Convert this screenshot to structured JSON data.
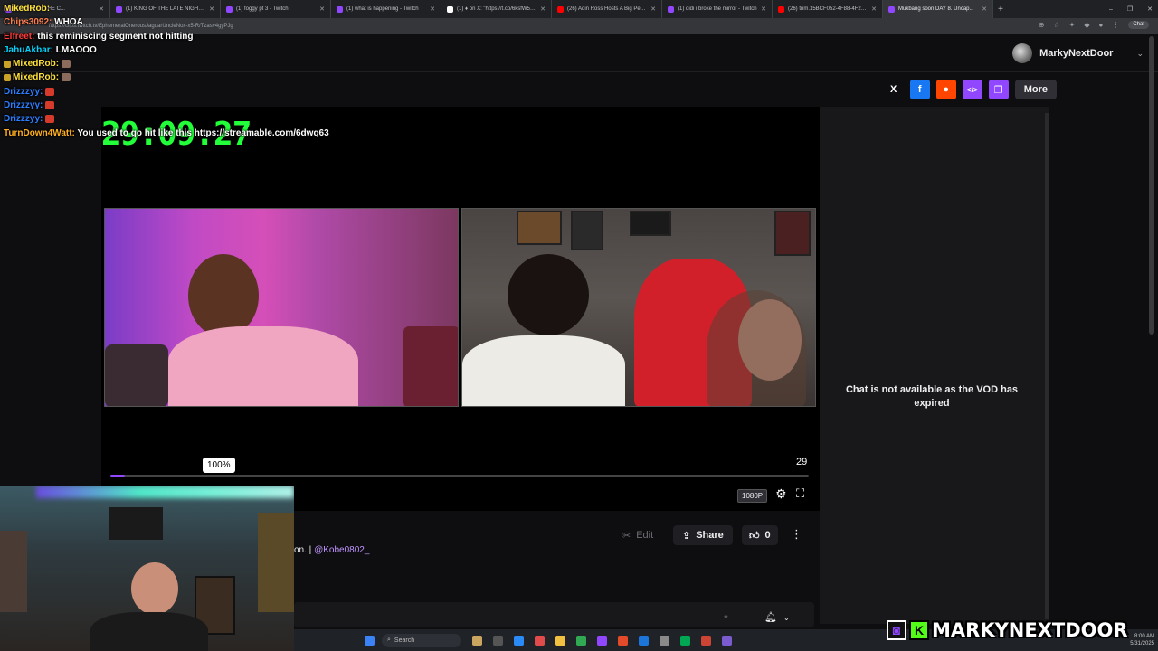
{
  "browser": {
    "tabs": [
      {
        "title": "4H BROKE THE C...",
        "color": "#9147ff"
      },
      {
        "title": "(1) KING OF THE LATE NIGHT IS L...",
        "color": "#9147ff"
      },
      {
        "title": "(1) foggy pt 3 - Twitch",
        "color": "#9147ff"
      },
      {
        "title": "(1) what is happening - Twitch",
        "color": "#9147ff"
      },
      {
        "title": "(1) ♦ on X: \"https://t.co/6ksfW5P...",
        "color": "#ffffff"
      },
      {
        "title": "(26) Adin Ross Hosts A Big People...",
        "color": "#ff0000"
      },
      {
        "title": "(1) didi i broke the mirror - Twitch",
        "color": "#9147ff"
      },
      {
        "title": "(26) trim.15BCF052-4F88-4F2E-9B...",
        "color": "#ff0000"
      },
      {
        "title": "Mukbang soon DAY 8. Uncap...",
        "color": "#9147ff"
      }
    ],
    "url": "https://clips.twitch.tv/EphemeralOnerousJaguarUncleNox-x5-R/Tzasv4gyPJg",
    "chat_button": "Chat"
  },
  "header": {
    "channel_name": "MarkyNextDoor"
  },
  "share": {
    "buttons": [
      {
        "name": "x",
        "glyph": "X",
        "bg": "transparent"
      },
      {
        "name": "facebook",
        "glyph": "f",
        "bg": "#1877f2"
      },
      {
        "name": "reddit",
        "glyph": "●",
        "bg": "#ff4500"
      },
      {
        "name": "embed",
        "glyph": "</>",
        "bg": "#9147ff"
      },
      {
        "name": "copy",
        "glyph": "❐",
        "bg": "#9147ff"
      }
    ],
    "more_label": "More"
  },
  "player": {
    "clock_overlay": "29:09.27",
    "timecode": "29",
    "volume_tooltip": "100%",
    "progress": 0.02,
    "quality": "1080P"
  },
  "clip_info": {
    "mention_prefix": "on. |",
    "mention_handle": "@Kobe0802_",
    "edit_label": "Edit",
    "share_label": "Share",
    "like_count": "0"
  },
  "chat_panel": {
    "message": "Chat is not available as the VOD has expired"
  },
  "overlay_chat": [
    {
      "user": "MikedRob:",
      "msg": "",
      "color": "#ffe23a",
      "emote": ""
    },
    {
      "user": "Chips3092:",
      "msg": "WHOA",
      "color": "#ff7f50",
      "emote": ""
    },
    {
      "user": "Elfreet:",
      "msg": "this reminiscing segment not hitting",
      "color": "#ff3b3b",
      "emote": ""
    },
    {
      "user": "JahuAkbar:",
      "msg": "LMAOOO",
      "color": "#00d5ff",
      "emote": ""
    },
    {
      "user": "MixedRob:",
      "msg": "",
      "color": "#ffe23a",
      "emote": "#8a6b5c",
      "badge": true
    },
    {
      "user": "MixedRob:",
      "msg": "",
      "color": "#ffe23a",
      "emote": "#8a6b5c",
      "badge": true
    },
    {
      "user": "Drizzzyy:",
      "msg": "",
      "color": "#2d7dff",
      "emote": "#d63a2a"
    },
    {
      "user": "Drizzzyy:",
      "msg": "",
      "color": "#2d7dff",
      "emote": "#d63a2a"
    },
    {
      "user": "Drizzzyy:",
      "msg": "",
      "color": "#2d7dff",
      "emote": "#d63a2a"
    },
    {
      "user": "TurnDown4Watt:",
      "msg": "You used to go hit like this https://streamable.com/6dwq63",
      "color": "#ffb020",
      "emote": ""
    }
  ],
  "taskbar": {
    "search_placeholder": "Search",
    "time": "8:00 AM",
    "date": "5/31/2025"
  },
  "brand": {
    "text": "MARKYNEXTDOOR"
  }
}
